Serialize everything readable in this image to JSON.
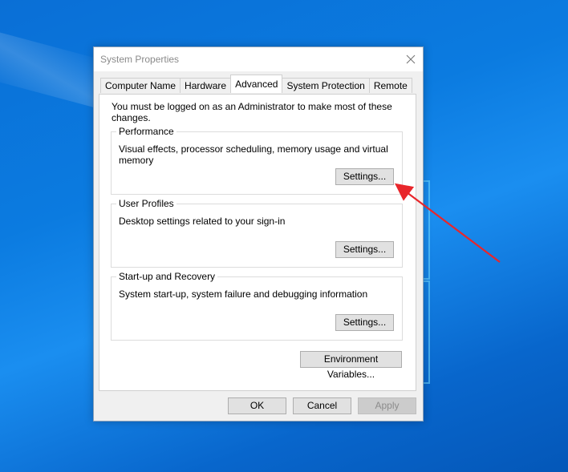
{
  "dialog": {
    "title": "System Properties",
    "tabs": [
      {
        "label": "Computer Name"
      },
      {
        "label": "Hardware"
      },
      {
        "label": "Advanced"
      },
      {
        "label": "System Protection"
      },
      {
        "label": "Remote"
      }
    ],
    "active_tab": "Advanced",
    "admin_note": "You must be logged on as an Administrator to make most of these changes.",
    "performance": {
      "title": "Performance",
      "description": "Visual effects, processor scheduling, memory usage and virtual memory",
      "settings_label": "Settings..."
    },
    "user_profiles": {
      "title": "User Profiles",
      "description": "Desktop settings related to your sign-in",
      "settings_label": "Settings..."
    },
    "startup_recovery": {
      "title": "Start-up and Recovery",
      "description": "System start-up, system failure and debugging information",
      "settings_label": "Settings..."
    },
    "env_vars_label": "Environment Variables...",
    "footer": {
      "ok_label": "OK",
      "cancel_label": "Cancel",
      "apply_label": "Apply"
    }
  },
  "colors": {
    "desktop": "#0b7be0",
    "annotation_arrow": "#e8262b"
  },
  "icons": {
    "close": "close-icon",
    "annotation": "arrow-annotation"
  }
}
